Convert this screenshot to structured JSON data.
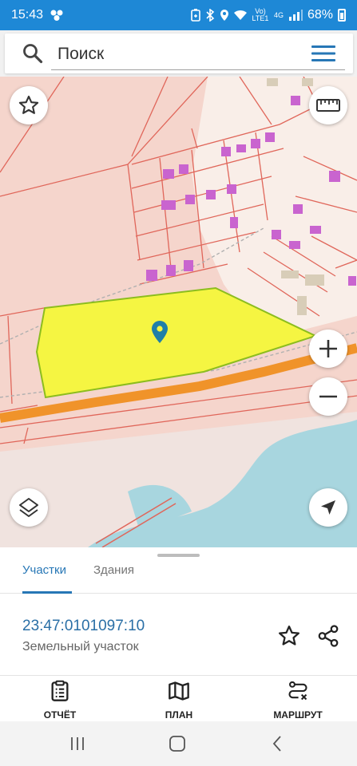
{
  "status_bar": {
    "time": "15:43",
    "network": "Vo) LTE1",
    "network_type": "4G",
    "battery": "68%",
    "icons": [
      "notification-dots-icon",
      "battery-saver-icon",
      "bluetooth-icon",
      "location-icon",
      "wifi-icon",
      "signal-icon",
      "battery-icon"
    ]
  },
  "search": {
    "placeholder": "Поиск"
  },
  "map": {
    "selected_parcel_color": "#f5f542",
    "road_color": "#f0932a",
    "water_color": "#a8d6df",
    "background_color": "#f5d5cc",
    "building_color": "#c964cf",
    "boundary_color": "#e0665a",
    "controls": [
      "favorite-star-icon",
      "ruler-icon",
      "zoom-in-icon",
      "zoom-out-icon",
      "layers-icon",
      "my-location-icon"
    ]
  },
  "sheet": {
    "tabs": [
      {
        "label": "Участки",
        "active": true
      },
      {
        "label": "Здания",
        "active": false
      }
    ],
    "parcel": {
      "number": "23:47:0101097:10",
      "type": "Земельный участок"
    },
    "actions": [
      {
        "label": "ОТЧЁТ",
        "icon": "report-icon"
      },
      {
        "label": "ПЛАН",
        "icon": "map-plan-icon"
      },
      {
        "label": "МАРШРУТ",
        "icon": "route-icon"
      }
    ]
  },
  "accent_color": "#2777b6"
}
